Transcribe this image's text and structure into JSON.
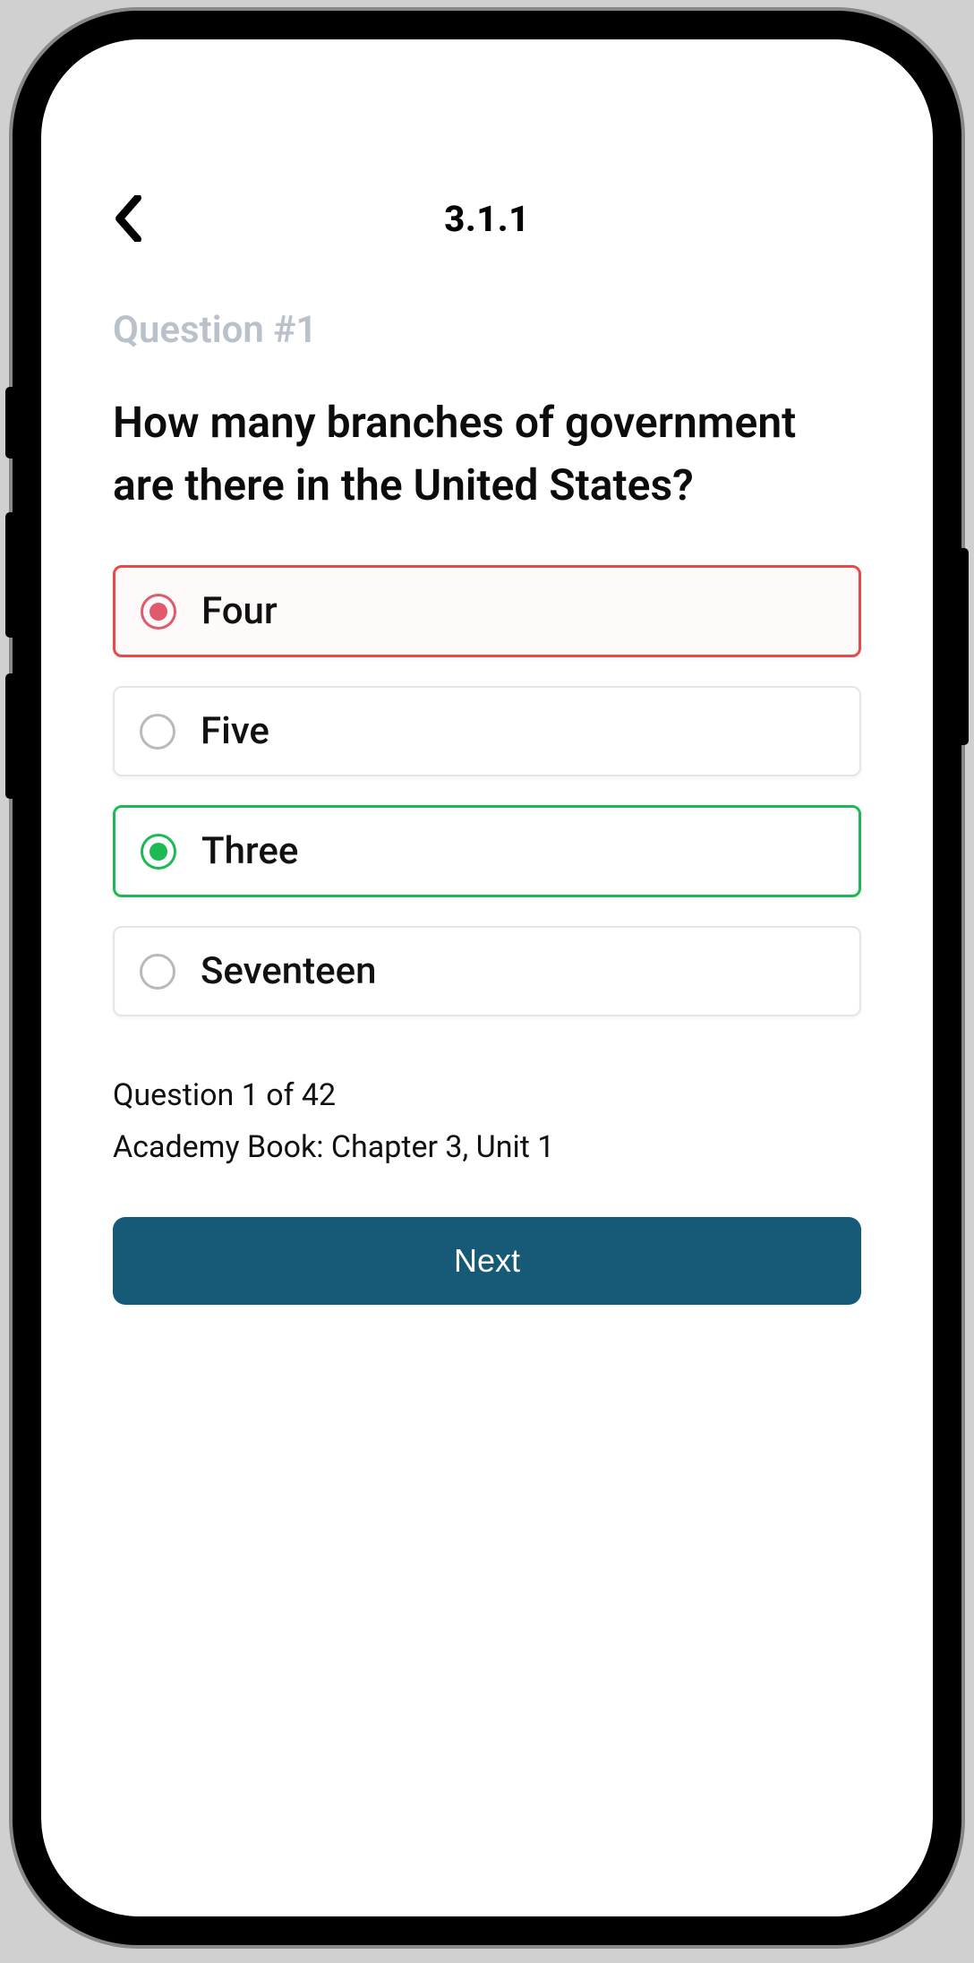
{
  "header": {
    "title": "3.1.1"
  },
  "question": {
    "label": "Question #1",
    "text": "How many branches of government are there in the United States?"
  },
  "options": [
    {
      "label": "Four",
      "state": "wrong"
    },
    {
      "label": "Five",
      "state": "default"
    },
    {
      "label": "Three",
      "state": "correct"
    },
    {
      "label": "Seventeen",
      "state": "default"
    }
  ],
  "progress": {
    "counter": "Question 1 of 42",
    "source": "Academy Book: Chapter 3, Unit 1"
  },
  "actions": {
    "next_label": "Next"
  }
}
